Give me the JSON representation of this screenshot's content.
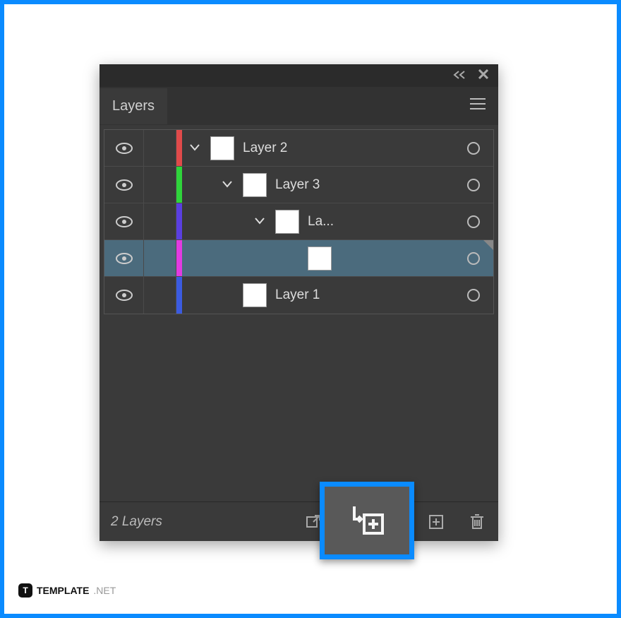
{
  "topbar": {
    "collapse_icon": "collapse",
    "close_icon": "close"
  },
  "panel": {
    "title": "Layers",
    "menu_icon": "menu"
  },
  "layers": [
    {
      "name": "Layer 2",
      "color": "#e04a4a",
      "indent": 0,
      "expanded": true,
      "selected": false,
      "show_target": true,
      "has_chevron": true,
      "has_thumb": true
    },
    {
      "name": "Layer 3",
      "color": "#2fd43b",
      "indent": 1,
      "expanded": true,
      "selected": false,
      "show_target": true,
      "has_chevron": true,
      "has_thumb": true
    },
    {
      "name": "La...",
      "color": "#5a3fe0",
      "indent": 2,
      "expanded": true,
      "selected": false,
      "show_target": true,
      "has_chevron": true,
      "has_thumb": true
    },
    {
      "name": "",
      "color": "#e23be2",
      "indent": 3,
      "expanded": false,
      "selected": true,
      "show_target": true,
      "has_chevron": false,
      "has_thumb": true
    },
    {
      "name": "Layer 1",
      "color": "#3b5be0",
      "indent": 1,
      "expanded": false,
      "selected": false,
      "show_target": true,
      "has_chevron": false,
      "has_thumb": true
    }
  ],
  "footer": {
    "count_label": "2 Layers",
    "icons": {
      "export": "export",
      "search": "search",
      "sublayer": "new-sublayer",
      "newlayer": "new-layer",
      "delete": "delete"
    }
  },
  "highlight": {
    "icon": "new-sublayer"
  },
  "attribution": {
    "bold": "TEMPLATE",
    "light": ".NET",
    "badge": "T"
  }
}
